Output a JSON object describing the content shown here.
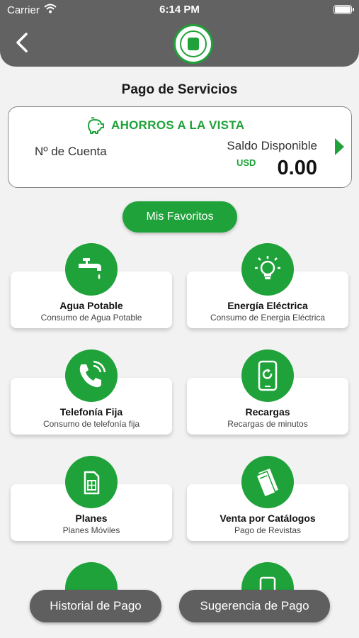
{
  "status_bar": {
    "carrier": "Carrier",
    "time": "6:14 PM"
  },
  "header": {
    "back_icon": "chevron-left-icon",
    "logo": "cooperative-logo"
  },
  "page": {
    "title": "Pago de Servicios"
  },
  "account": {
    "type": "AHORROS A LA VISTA",
    "number_label": "Nº de Cuenta",
    "balance_label": "Saldo Disponible",
    "currency": "USD",
    "balance": "0.00"
  },
  "favorites": {
    "label": "Mis Favoritos"
  },
  "services": [
    {
      "name": "Agua Potable",
      "desc": "Consumo de Agua Potable",
      "icon": "faucet-icon"
    },
    {
      "name": "Energía Eléctrica",
      "desc": "Consumo de Energia Eléctrica",
      "icon": "lightbulb-icon"
    },
    {
      "name": "Telefonía Fija",
      "desc": "Consumo de telefonía fija",
      "icon": "phone-icon"
    },
    {
      "name": "Recargas",
      "desc": "Recargas de minutos",
      "icon": "mobile-recharge-icon"
    },
    {
      "name": "Planes",
      "desc": "Planes Móviles",
      "icon": "sim-card-icon"
    },
    {
      "name": "Venta por Catálogos",
      "desc": "Pago de Revistas",
      "icon": "catalog-icon"
    }
  ],
  "bottom": {
    "history": "Historial de Pago",
    "suggestion": "Sugerencia de Pago"
  },
  "colors": {
    "accent": "#1fa23a",
    "header": "#626262",
    "button_dark": "#5f5f5f"
  }
}
